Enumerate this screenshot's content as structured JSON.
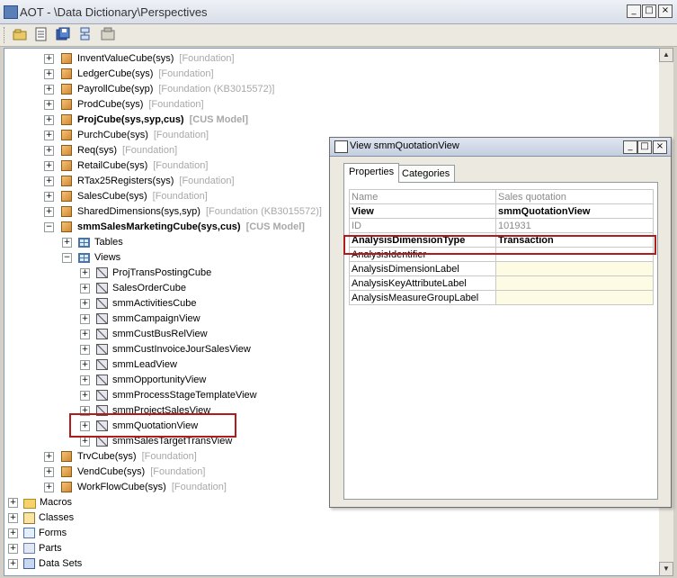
{
  "window": {
    "title": "AOT - \\Data Dictionary\\Perspectives"
  },
  "toolbar": {
    "icons": [
      "open-icon",
      "properties-icon",
      "save-all-icon",
      "import-icon",
      "compile-icon"
    ]
  },
  "tree": {
    "items": [
      {
        "label": "InventValueCube(sys)",
        "layer": "[Foundation]"
      },
      {
        "label": "LedgerCube(sys)",
        "layer": "[Foundation]"
      },
      {
        "label": "PayrollCube(syp)",
        "layer": "[Foundation (KB3015572)]"
      },
      {
        "label": "ProdCube(sys)",
        "layer": "[Foundation]"
      },
      {
        "label": "ProjCube(sys,syp,cus)",
        "layer": "[CUS Model]"
      },
      {
        "label": "PurchCube(sys)",
        "layer": "[Foundation]"
      },
      {
        "label": "Req(sys)",
        "layer": "[Foundation]"
      },
      {
        "label": "RetailCube(sys)",
        "layer": "[Foundation]"
      },
      {
        "label": "RTax25Registers(sys)",
        "layer": "[Foundation]"
      },
      {
        "label": "SalesCube(sys)",
        "layer": "[Foundation]"
      },
      {
        "label": "SharedDimensions(sys,syp)",
        "layer": "[Foundation (KB3015572)]"
      },
      {
        "label": "smmSalesMarketingCube(sys,cus)",
        "layer": "[CUS Model]"
      },
      {
        "label": "Tables"
      },
      {
        "label": "Views"
      },
      {
        "label": "ProjTransPostingCube"
      },
      {
        "label": "SalesOrderCube"
      },
      {
        "label": "smmActivitiesCube"
      },
      {
        "label": "smmCampaignView"
      },
      {
        "label": "smmCustBusRelView"
      },
      {
        "label": "smmCustInvoiceJourSalesView"
      },
      {
        "label": "smmLeadView"
      },
      {
        "label": "smmOpportunityView"
      },
      {
        "label": "smmProcessStageTemplateView"
      },
      {
        "label": "smmProjectSalesView"
      },
      {
        "label": "smmQuotationView"
      },
      {
        "label": "smmSalesTargetTransView"
      },
      {
        "label": "TrvCube(sys)",
        "layer": "[Foundation]"
      },
      {
        "label": "VendCube(sys)",
        "layer": "[Foundation]"
      },
      {
        "label": "WorkFlowCube(sys)",
        "layer": "[Foundation]"
      },
      {
        "label": "Macros"
      },
      {
        "label": "Classes"
      },
      {
        "label": "Forms"
      },
      {
        "label": "Parts"
      },
      {
        "label": "Data Sets"
      }
    ]
  },
  "properties": {
    "title": "View smmQuotationView",
    "tabs": [
      "Properties",
      "Categories"
    ],
    "rows": [
      {
        "name": "Name",
        "value": "Sales quotation"
      },
      {
        "name": "View",
        "value": "smmQuotationView"
      },
      {
        "name": "ID",
        "value": "101931"
      },
      {
        "name": "AnalysisDimensionType",
        "value": "Transaction"
      },
      {
        "name": "AnalysisIdentifier",
        "value": ""
      },
      {
        "name": "AnalysisDimensionLabel",
        "value": ""
      },
      {
        "name": "AnalysisKeyAttributeLabel",
        "value": ""
      },
      {
        "name": "AnalysisMeasureGroupLabel",
        "value": ""
      }
    ]
  },
  "colors": {
    "highlight": "#b01c1c",
    "layer_text": "#a8a8a8"
  }
}
